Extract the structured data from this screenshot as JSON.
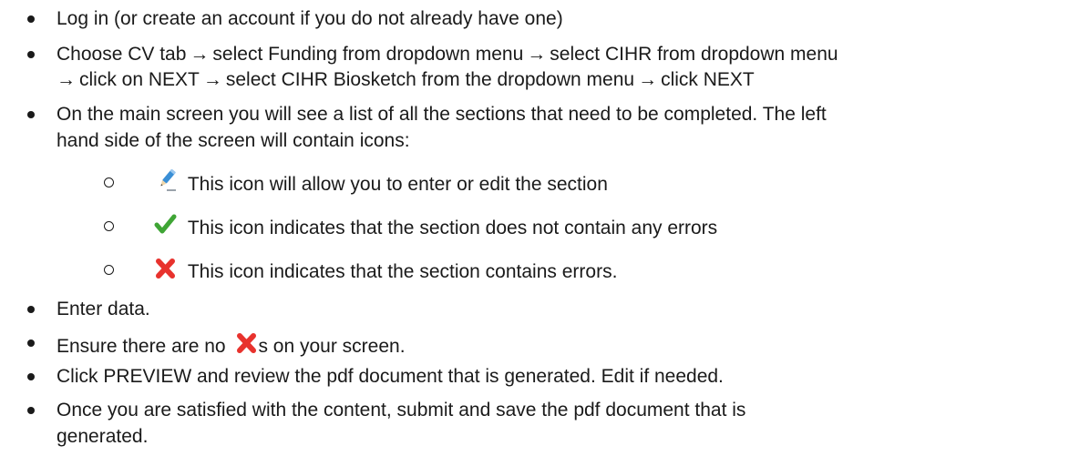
{
  "items": [
    {
      "text": "Log in (or create an account if you do not already have one)"
    },
    {
      "line1": [
        "Choose CV tab",
        "select Funding from dropdown menu",
        "select CIHR from dropdown menu"
      ],
      "line2": [
        "click on NEXT",
        "select CIHR Biosketch from the dropdown menu",
        "click NEXT"
      ],
      "arrow": "→"
    },
    {
      "line1": "On the main screen you will see a list of all the sections that need to be completed.  The left",
      "line2": "hand side of the screen will contain icons:"
    },
    {
      "text": "Enter data."
    },
    {
      "before": "Ensure there are no",
      "after": "s on your screen."
    },
    {
      "text": "Click PREVIEW and review the pdf document that is generated.  Edit if needed."
    },
    {
      "line1": "Once you are satisfied with the content, submit and save the pdf document that is",
      "line2": "generated."
    }
  ],
  "icon_items": [
    {
      "icon": "pencil-icon",
      "text": "This icon will allow you to enter or edit the section"
    },
    {
      "icon": "checkmark-icon",
      "text": "This icon indicates that the section does not contain any errors"
    },
    {
      "icon": "red-x-icon",
      "text": "This icon indicates that the section contains errors."
    }
  ],
  "sub_bullet_glyph": "o",
  "colors": {
    "check_green": "#3fa535",
    "x_red": "#e8322d",
    "pencil_blue": "#3a8fd6"
  }
}
